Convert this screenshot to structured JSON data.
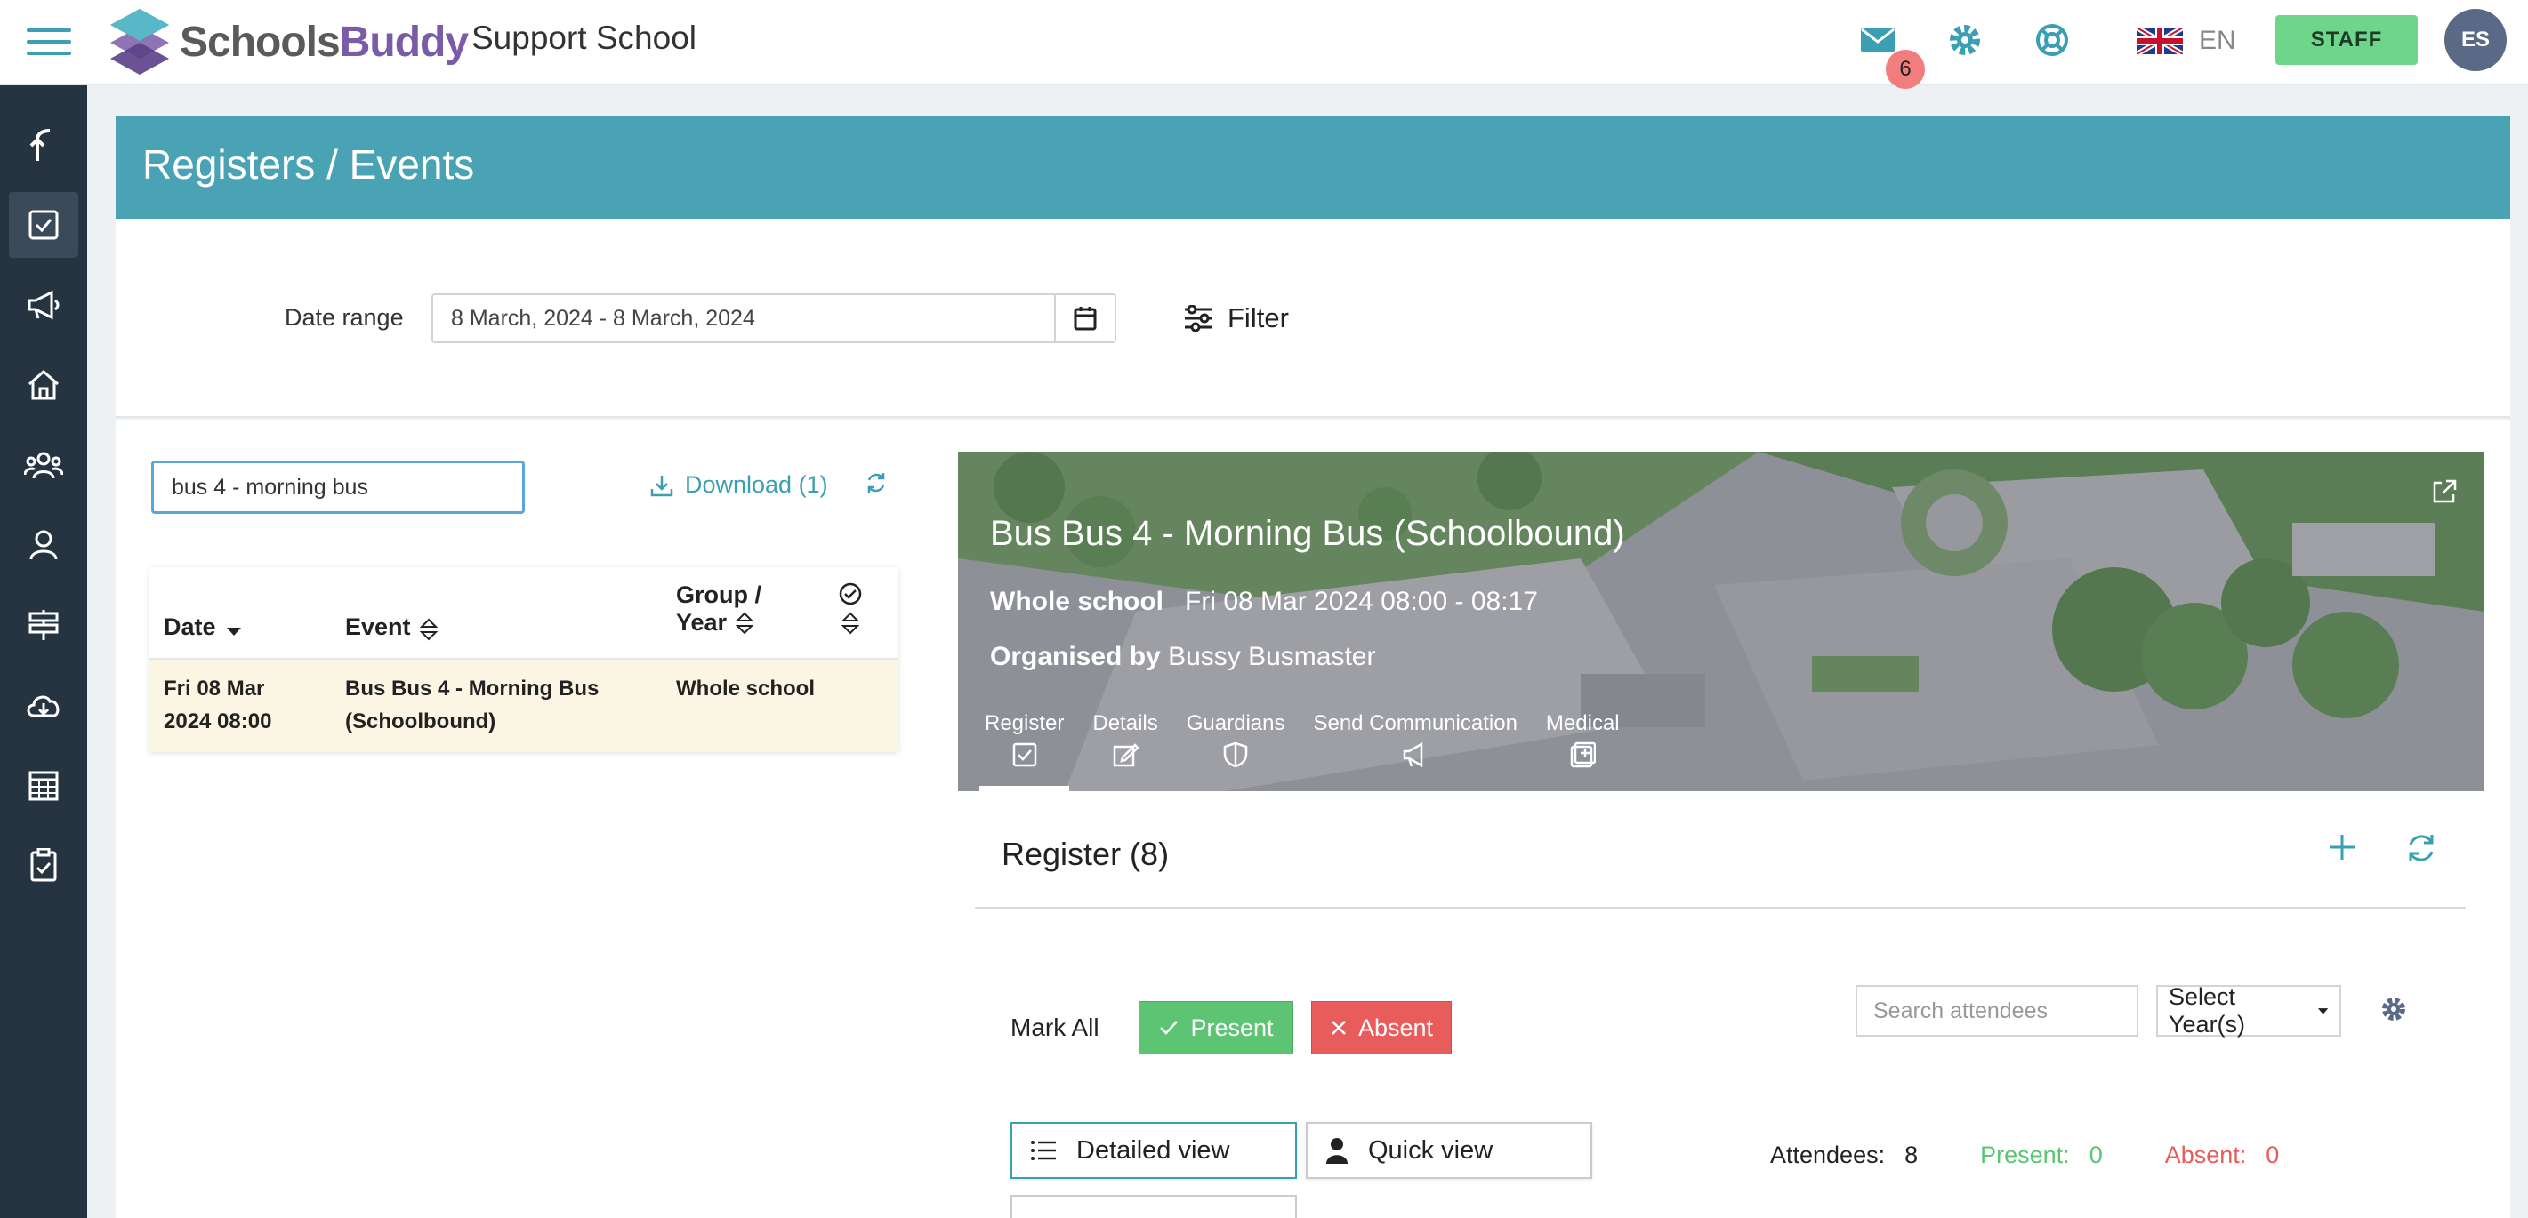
{
  "header": {
    "logo_part1": "Schools",
    "logo_part2": "Buddy",
    "school_name": "Support School",
    "unread_count": "6",
    "language": "EN",
    "role_button": "STAFF",
    "avatar_initials": "ES"
  },
  "page": {
    "title": "Registers / Events"
  },
  "filters": {
    "date_label": "Date range",
    "date_value": "8 March, 2024 - 8 March, 2024",
    "filter_label": "Filter"
  },
  "list": {
    "search_value": "bus 4 - morning bus",
    "download_label": "Download (1)",
    "columns": {
      "date": "Date",
      "event": "Event",
      "group_line1": "Group /",
      "group_line2": "Year"
    },
    "rows": [
      {
        "date_line1": "Fri 08 Mar",
        "date_line2": "2024 08:00",
        "event_line1": "Bus Bus 4 - Morning Bus",
        "event_line2": "(Schoolbound)",
        "group": "Whole school"
      }
    ]
  },
  "event": {
    "title": "Bus Bus 4 - Morning Bus (Schoolbound)",
    "scope": "Whole school",
    "datetime": "Fri 08 Mar 2024 08:00 - 08:17",
    "organised_prefix": "Organised by",
    "organiser": "Bussy Busmaster",
    "tabs": [
      "Register",
      "Details",
      "Guardians",
      "Send Communication",
      "Medical"
    ]
  },
  "register": {
    "title": "Register (8)",
    "mark_all": "Mark All",
    "present_btn": "Present",
    "absent_btn": "Absent",
    "search_placeholder": "Search attendees",
    "select_year": "Select Year(s)",
    "detailed_view": "Detailed view",
    "quick_view": "Quick view",
    "attendees_label": "Attendees:",
    "attendees_count": "8",
    "present_label": "Present:",
    "present_count": "0",
    "absent_label": "Absent:",
    "absent_count": "0"
  },
  "colors": {
    "accent": "#4aa3b5",
    "sidebar": "#263441",
    "present": "#5cc473",
    "absent": "#e95c5c",
    "staff": "#6ed68a"
  }
}
